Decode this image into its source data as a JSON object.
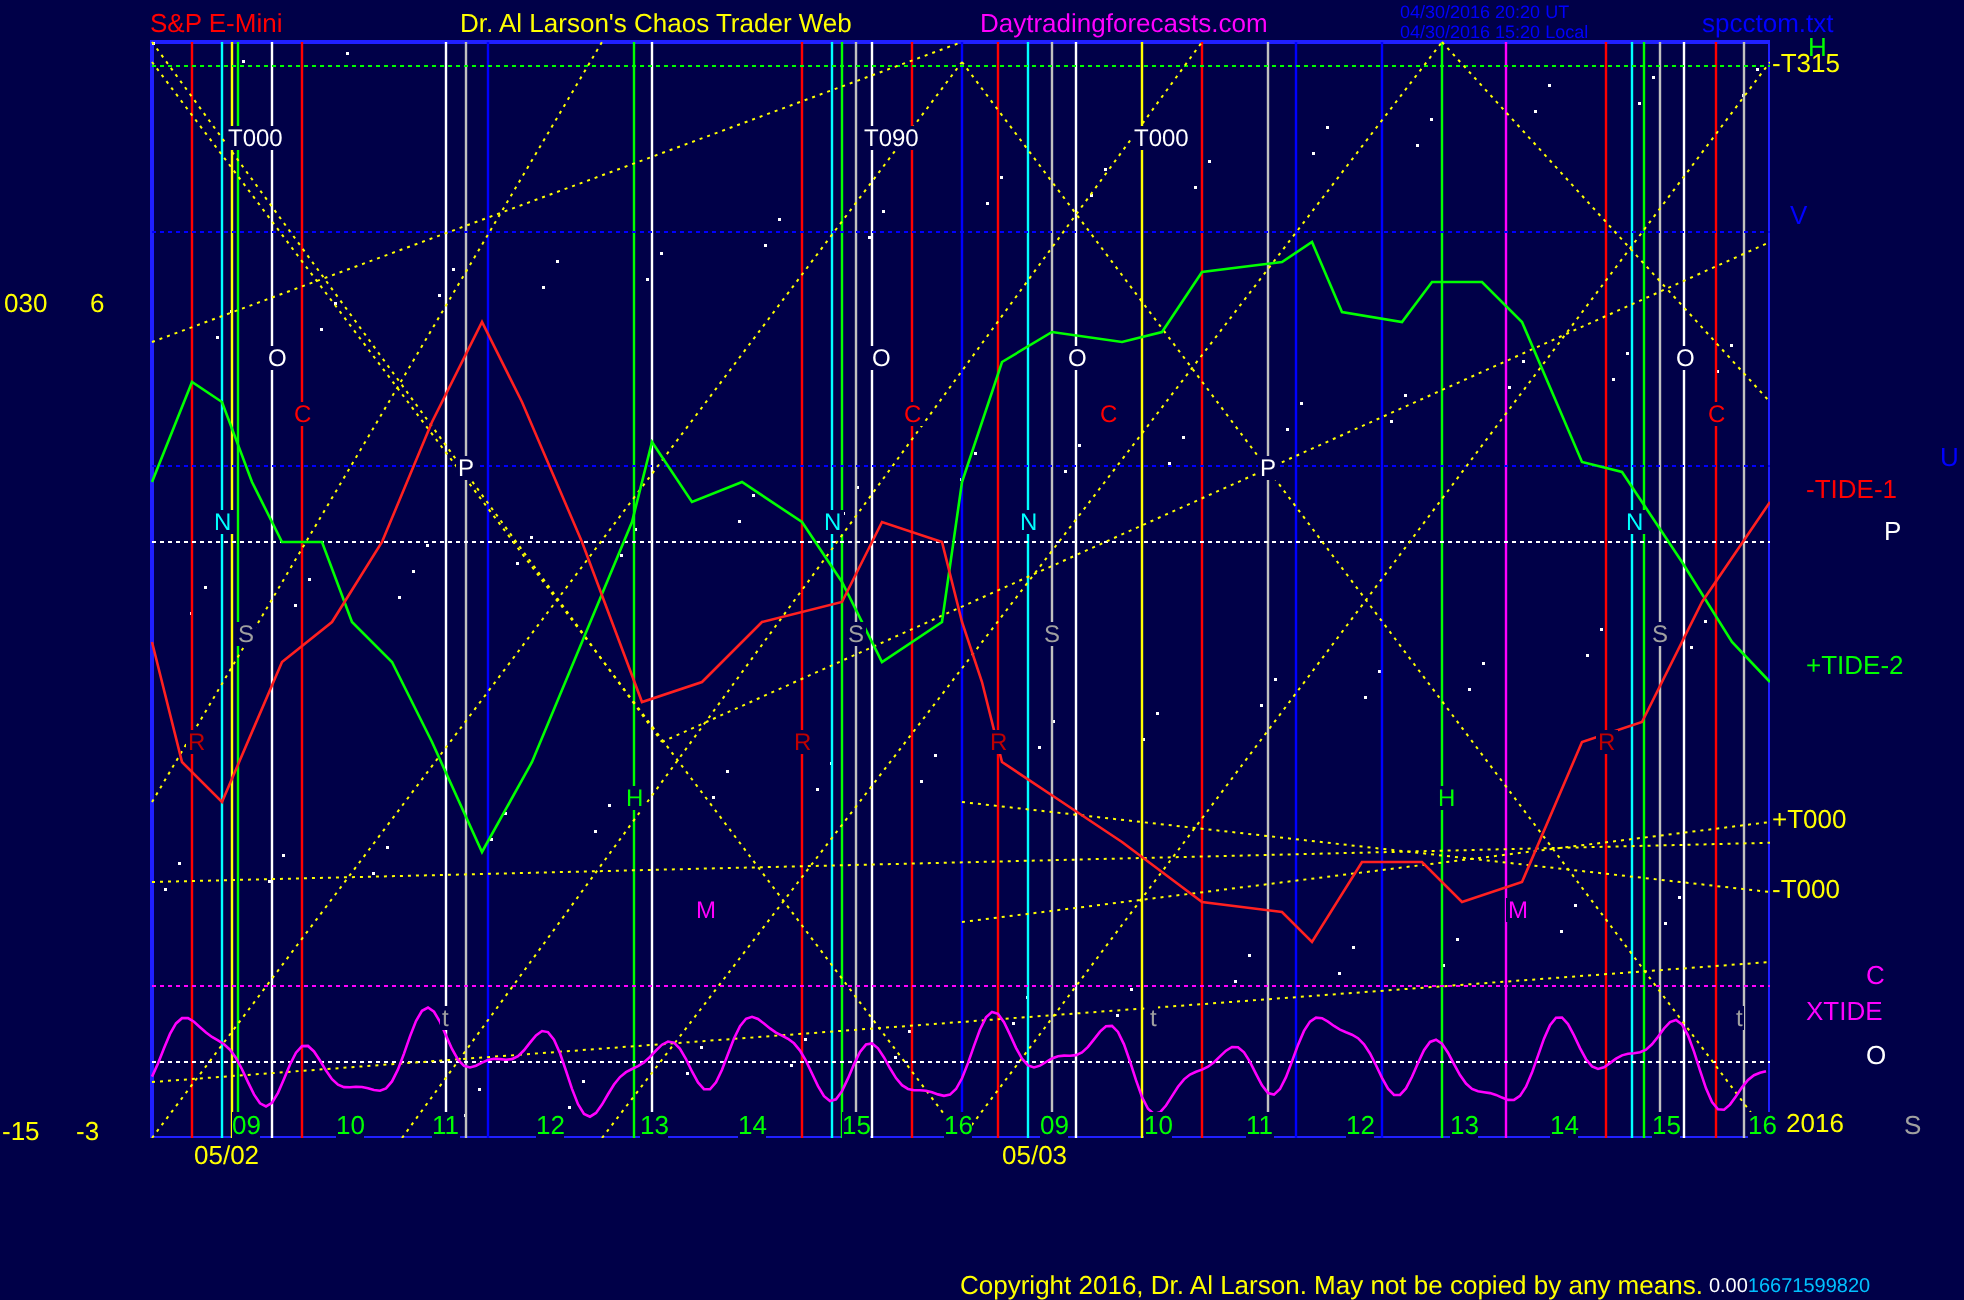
{
  "header": {
    "symbol": "S&P E-Mini",
    "title": "Dr. Al Larson's Chaos Trader Web",
    "site": "Daytradingforecasts.com",
    "timestamps": [
      "04/30/2016 20:20 UT",
      "04/30/2016 15:20 Local"
    ],
    "file": "spcctom.txt"
  },
  "left_axis": [
    "030",
    "6",
    "-15",
    "-3"
  ],
  "chart_labels": [
    {
      "text": "T000",
      "color": "#ffffff"
    },
    {
      "text": "T090",
      "color": "#ffffff"
    },
    {
      "text": "T000",
      "color": "#ffffff"
    },
    {
      "text": "O",
      "color": "#ffffff"
    },
    {
      "text": "O",
      "color": "#ffffff"
    },
    {
      "text": "O",
      "color": "#ffffff"
    },
    {
      "text": "O",
      "color": "#ffffff"
    },
    {
      "text": "C",
      "color": "#ff0000"
    },
    {
      "text": "C",
      "color": "#ff0000"
    },
    {
      "text": "C",
      "color": "#ff0000"
    },
    {
      "text": "C",
      "color": "#ff0000"
    },
    {
      "text": "P",
      "color": "#ffffff"
    },
    {
      "text": "P",
      "color": "#ffffff"
    },
    {
      "text": "N",
      "color": "#00ffff"
    },
    {
      "text": "N",
      "color": "#00ffff"
    },
    {
      "text": "N",
      "color": "#00ffff"
    },
    {
      "text": "N",
      "color": "#00ffff"
    },
    {
      "text": "S",
      "color": "#a0a0a0"
    },
    {
      "text": "S",
      "color": "#a0a0a0"
    },
    {
      "text": "S",
      "color": "#a0a0a0"
    },
    {
      "text": "S",
      "color": "#a0a0a0"
    },
    {
      "text": "R",
      "color": "#c00000"
    },
    {
      "text": "R",
      "color": "#c00000"
    },
    {
      "text": "R",
      "color": "#c00000"
    },
    {
      "text": "R",
      "color": "#c00000"
    },
    {
      "text": "H",
      "color": "#00ff00"
    },
    {
      "text": "H",
      "color": "#00ff00"
    },
    {
      "text": "M",
      "color": "#ff00ff"
    },
    {
      "text": "M",
      "color": "#ff00ff"
    },
    {
      "text": "t",
      "color": "#a0a0a0"
    },
    {
      "text": "t",
      "color": "#a0a0a0"
    },
    {
      "text": "t",
      "color": "#a0a0a0"
    }
  ],
  "scale_labels": [
    {
      "text": "H",
      "color": "#00ff00"
    },
    {
      "text": "-T315",
      "color": "#ffff00"
    },
    {
      "text": "V",
      "color": "#0000ff"
    },
    {
      "text": "U",
      "color": "#0000ff"
    },
    {
      "text": "-TIDE-1",
      "color": "#ff0000"
    },
    {
      "text": "P",
      "color": "#ffffff"
    },
    {
      "text": "+TIDE-2",
      "color": "#00ff00"
    },
    {
      "text": "+T000",
      "color": "#ffff00"
    },
    {
      "text": "-T000",
      "color": "#ffff00"
    },
    {
      "text": "C",
      "color": "#ff00ff"
    },
    {
      "text": "XTIDE",
      "color": "#ff00ff"
    },
    {
      "text": "O",
      "color": "#ffffff"
    },
    {
      "text": "2016",
      "color": "#ffff00"
    },
    {
      "text": "S",
      "color": "#a0a0a0"
    }
  ],
  "hours": [
    "09",
    "10",
    "11",
    "12",
    "13",
    "14",
    "15",
    "16",
    "09",
    "10",
    "11",
    "12",
    "13",
    "14",
    "15",
    "16"
  ],
  "dates": [
    "05/02",
    "05/03"
  ],
  "footer": {
    "copyright": "Copyright 2016, Dr. Al Larson. May not be copied by any means.",
    "value_1": "0.00",
    "value_2": "16671599820"
  }
}
